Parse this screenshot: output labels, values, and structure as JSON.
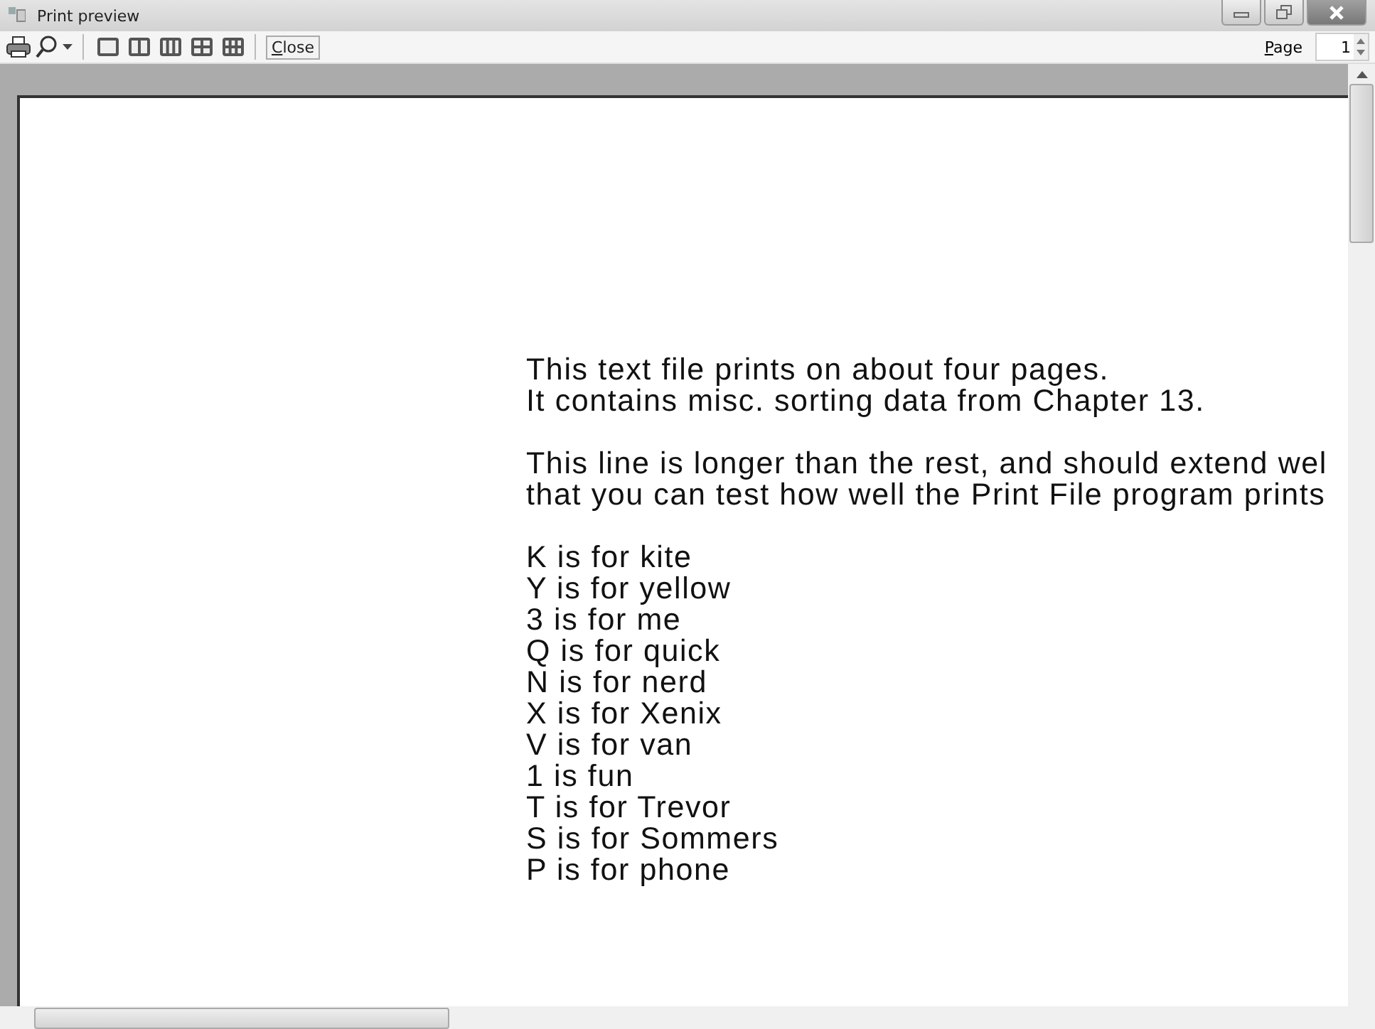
{
  "window": {
    "title": "Print preview"
  },
  "toolbar": {
    "layouts": [
      {
        "kind": "one"
      },
      {
        "kind": "two"
      },
      {
        "kind": "three"
      },
      {
        "kind": "four"
      },
      {
        "kind": "six"
      }
    ],
    "close_button": "Close",
    "page_label": "Page",
    "page_value": "1"
  },
  "document": {
    "paragraphs": [
      [
        "This text file prints on about four pages.",
        "It contains misc. sorting data from Chapter 13."
      ],
      [
        "This line is longer than the rest, and should extend wel",
        "that you can test how well the Print File program prints"
      ],
      [
        "K is for kite",
        "Y is for yellow",
        "3 is for me",
        "Q is for quick",
        "N is for nerd",
        "X is for Xenix",
        "V is for van",
        "1 is fun",
        "T is for Trevor",
        "S is for Sommers",
        "P is for phone"
      ]
    ]
  }
}
